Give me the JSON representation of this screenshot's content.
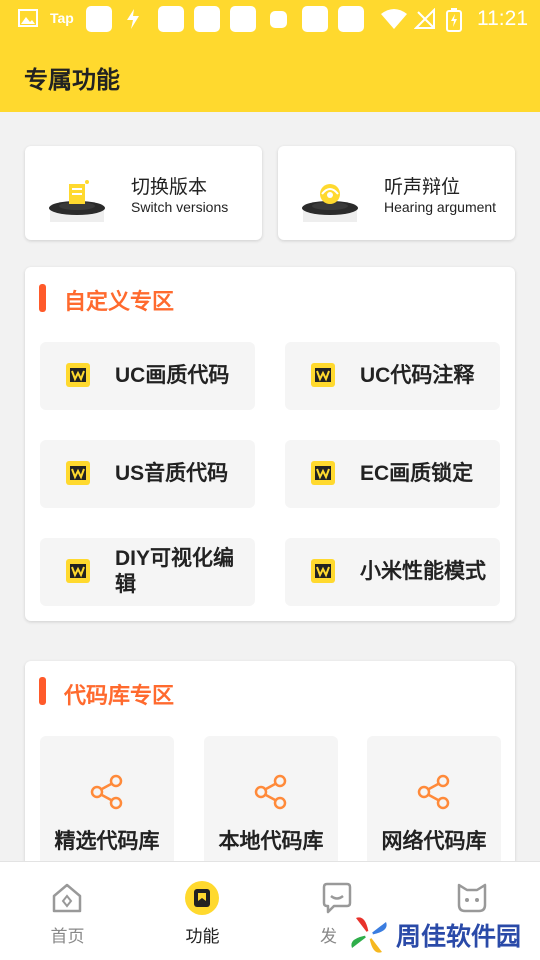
{
  "status_bar": {
    "tap_label": "Tap",
    "time": "11:21"
  },
  "header": {
    "title": "专属功能"
  },
  "top_cards": [
    {
      "title": "切换版本",
      "subtitle": "Switch versions"
    },
    {
      "title": "听声辩位",
      "subtitle": "Hearing argument"
    }
  ],
  "custom_section": {
    "title": "自定义专区",
    "items": [
      {
        "label": "UC画质代码"
      },
      {
        "label": "UC代码注释"
      },
      {
        "label": "US音质代码"
      },
      {
        "label": "EC画质锁定"
      },
      {
        "label": "DIY可视化编辑"
      },
      {
        "label": "小米性能模式"
      }
    ]
  },
  "library_section": {
    "title": "代码库专区",
    "items": [
      {
        "label": "精选代码库"
      },
      {
        "label": "本地代码库"
      },
      {
        "label": "网络代码库"
      }
    ]
  },
  "bottom_nav": [
    {
      "label": "首页",
      "icon": "home-icon"
    },
    {
      "label": "功能",
      "icon": "bookmark-icon"
    },
    {
      "label": "发",
      "icon": "chat-icon"
    },
    {
      "label": "",
      "icon": "cat-icon"
    }
  ],
  "watermark": {
    "text": "周佳软件园"
  },
  "colors": {
    "accent": "#ffd92e",
    "section": "#ff6a2e",
    "bar": "#ff5a2a",
    "watermark": "#2a4aa8"
  }
}
